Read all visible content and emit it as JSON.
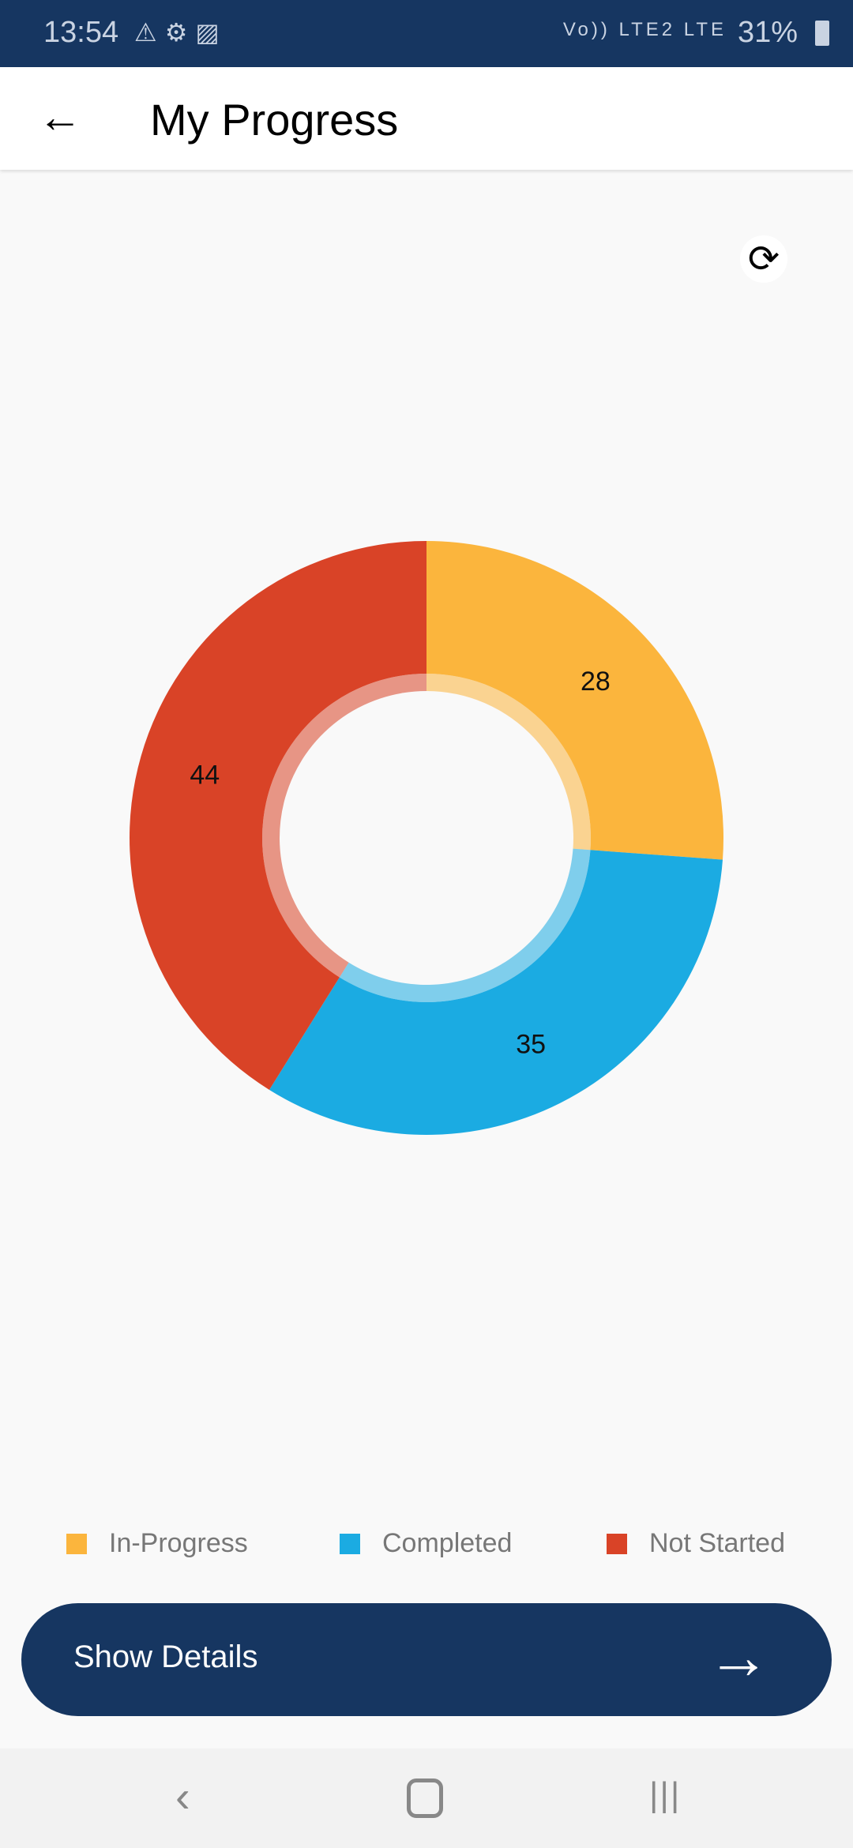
{
  "status_bar": {
    "time": "13:54",
    "left_icons": [
      "warning-icon",
      "settings-icon",
      "image-icon"
    ],
    "network": "Vo)) LTE2 LTE",
    "battery": "31%"
  },
  "app_bar": {
    "title": "My Progress",
    "back_icon": "arrow-left-icon"
  },
  "refresh_icon": "refresh-icon",
  "chart_data": {
    "type": "pie",
    "donut": true,
    "categories": [
      "In-Progress",
      "Completed",
      "Not Started"
    ],
    "values": [
      28,
      35,
      44
    ],
    "colors": [
      "#fbb53d",
      "#1babe2",
      "#d94327"
    ],
    "legend_placement": "bottom"
  },
  "button": {
    "label": "Show Details",
    "icon": "arrow-right-icon"
  },
  "nav": {
    "icons": [
      "back-icon",
      "home-icon",
      "recents-icon"
    ]
  }
}
